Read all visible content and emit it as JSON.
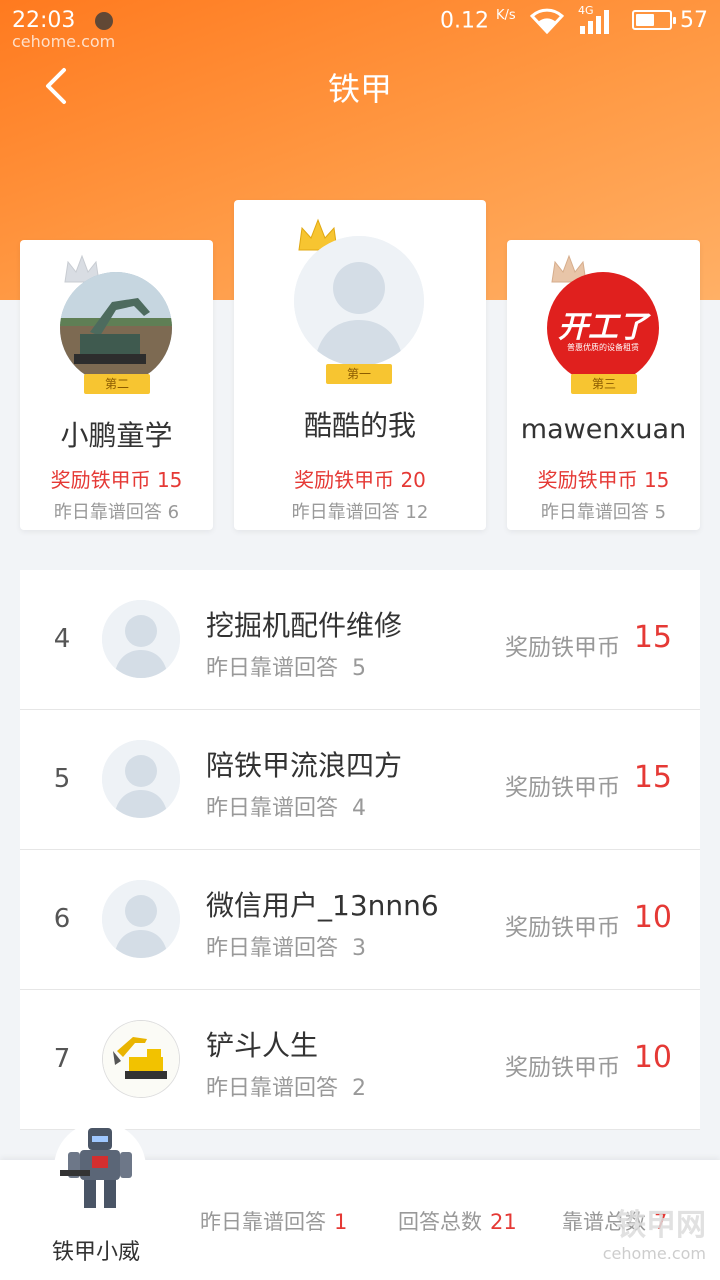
{
  "status_bar": {
    "time": "22:03",
    "speed": "0.12",
    "speed_unit": "K/s",
    "network": "4G",
    "battery": "57",
    "battery_level": 0.57,
    "watermark": "cehome.com"
  },
  "nav": {
    "title": "铁甲"
  },
  "podium": [
    {
      "rank_label": "第二",
      "name": "小鹏童学",
      "reward_label": "奖励铁甲币",
      "reward": "15",
      "yest_label": "昨日靠谱回答",
      "yest": "6"
    },
    {
      "rank_label": "第一",
      "name": "酷酷的我",
      "reward_label": "奖励铁甲币",
      "reward": "20",
      "yest_label": "昨日靠谱回答",
      "yest": "12"
    },
    {
      "rank_label": "第三",
      "name": "mawenxuan",
      "reward_label": "奖励铁甲币",
      "reward": "15",
      "yest_label": "昨日靠谱回答",
      "yest": "5",
      "logo_text": "开工了",
      "logo_sub": "普惠优质的设备租赁"
    }
  ],
  "list": [
    {
      "rank": "4",
      "name": "挖掘机配件维修",
      "yest_label": "昨日靠谱回答",
      "yest": "5",
      "reward_label": "奖励铁甲币",
      "reward": "15"
    },
    {
      "rank": "5",
      "name": "陪铁甲流浪四方",
      "yest_label": "昨日靠谱回答",
      "yest": "4",
      "reward_label": "奖励铁甲币",
      "reward": "15"
    },
    {
      "rank": "6",
      "name": "微信用户_13nnn6",
      "yest_label": "昨日靠谱回答",
      "yest": "3",
      "reward_label": "奖励铁甲币",
      "reward": "10"
    },
    {
      "rank": "7",
      "name": "铲斗人生",
      "yest_label": "昨日靠谱回答",
      "yest": "2",
      "reward_label": "奖励铁甲币",
      "reward": "10"
    }
  ],
  "me": {
    "name": "铁甲小威",
    "yest_label": "昨日靠谱回答",
    "yest": "1",
    "total_label": "回答总数",
    "total": "21",
    "reliable_label": "靠谱总数",
    "reliable": "7"
  },
  "watermark": {
    "brand": "铁甲网",
    "site": "cehome.com"
  },
  "colors": {
    "accent": "#ff8a30",
    "reward": "#e53935",
    "crown_gold": "#f7c531"
  }
}
